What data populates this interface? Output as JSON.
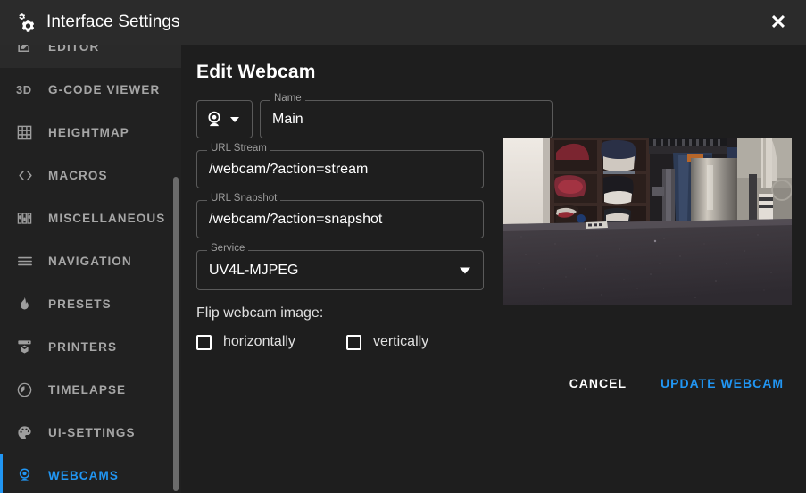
{
  "window": {
    "title": "Interface Settings",
    "icon": "gears-icon",
    "close_label": "✕"
  },
  "sidebar": {
    "items": [
      {
        "label": "EDITOR",
        "icon": "editor-icon",
        "icon_glyph": "",
        "state": "hovered",
        "name": "editor"
      },
      {
        "label": "G-CODE VIEWER",
        "icon": "gcode-3d-icon",
        "icon_glyph": "3D",
        "state": "normal",
        "name": "g-code-viewer"
      },
      {
        "label": "HEIGHTMAP",
        "icon": "grid-icon",
        "icon_glyph": "",
        "state": "normal",
        "name": "heightmap"
      },
      {
        "label": "MACROS",
        "icon": "code-brackets-icon",
        "icon_glyph": "< >",
        "state": "normal",
        "name": "macros"
      },
      {
        "label": "MISCELLANEOUS",
        "icon": "sliders-icon",
        "icon_glyph": "",
        "state": "normal",
        "name": "miscellaneous"
      },
      {
        "label": "NAVIGATION",
        "icon": "hamburger-icon",
        "icon_glyph": "",
        "state": "normal",
        "name": "navigation"
      },
      {
        "label": "PRESETS",
        "icon": "flame-icon",
        "icon_glyph": "",
        "state": "normal",
        "name": "presets"
      },
      {
        "label": "PRINTERS",
        "icon": "printer-3d-icon",
        "icon_glyph": "",
        "state": "normal",
        "name": "printers"
      },
      {
        "label": "TIMELAPSE",
        "icon": "timelapse-icon",
        "icon_glyph": "",
        "state": "normal",
        "name": "timelapse"
      },
      {
        "label": "UI-SETTINGS",
        "icon": "palette-icon",
        "icon_glyph": "",
        "state": "normal",
        "name": "ui-settings"
      },
      {
        "label": "WEBCAMS",
        "icon": "webcam-icon",
        "icon_glyph": "",
        "state": "active",
        "name": "webcams"
      }
    ],
    "scrollbar": {
      "visible": true
    }
  },
  "main": {
    "title": "Edit Webcam",
    "type_selector": {
      "icon": "webcam-icon",
      "caret": "chevron-down-icon"
    },
    "fields": {
      "name": {
        "label": "Name",
        "value": "Main"
      },
      "url_stream": {
        "label": "URL Stream",
        "value": "/webcam/?action=stream"
      },
      "url_snapshot": {
        "label": "URL Snapshot",
        "value": "/webcam/?action=snapshot"
      },
      "service": {
        "label": "Service",
        "value": "UV4L-MJPEG"
      }
    },
    "flip": {
      "label": "Flip webcam image:",
      "horizontal": {
        "label": "horizontally",
        "checked": false
      },
      "vertical": {
        "label": "vertically",
        "checked": false
      }
    },
    "preview": {
      "alt": "webcam-live-preview"
    },
    "actions": {
      "cancel": "CANCEL",
      "update": "UPDATE WEBCAM"
    }
  },
  "colors": {
    "accent": "#2196f3",
    "window_bar": "#2b2b2b",
    "sidebar_bg": "#212121",
    "panel_bg": "#1e1e1e",
    "field_border": "#5a5a5a",
    "muted_text": "#9e9e9e"
  }
}
